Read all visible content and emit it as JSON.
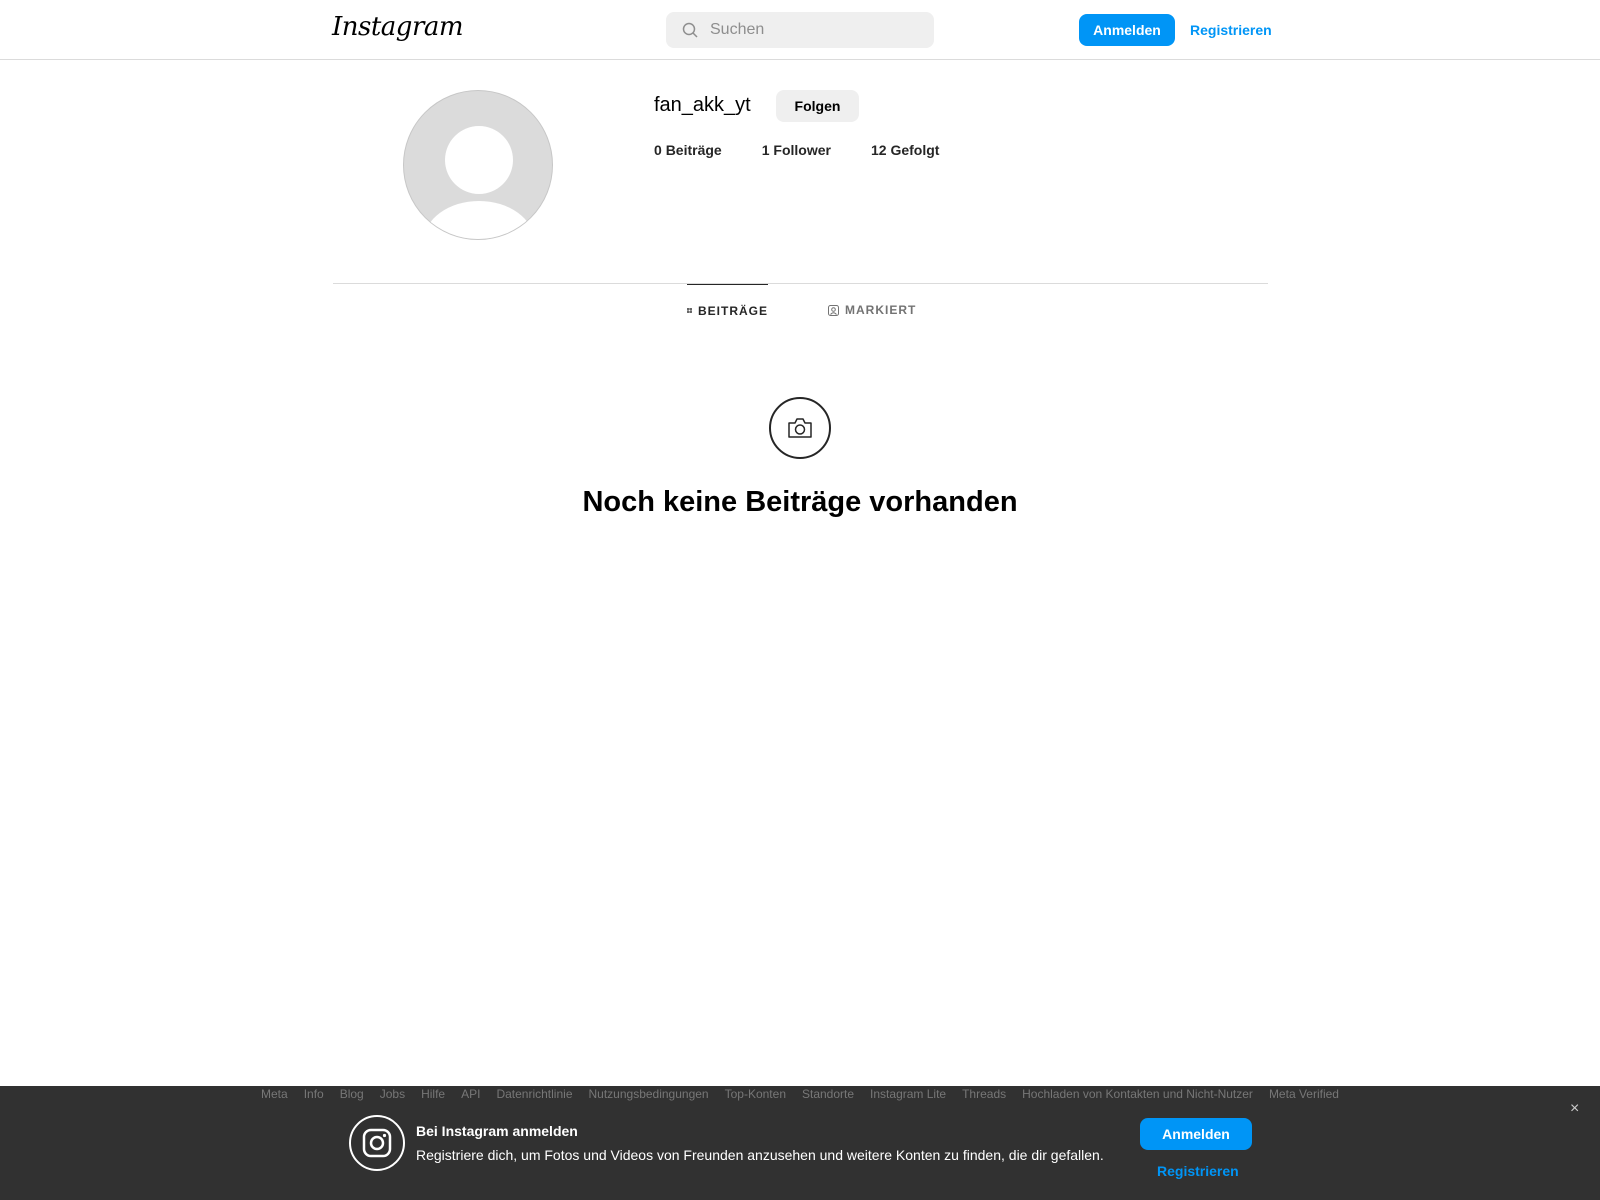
{
  "header": {
    "logo": "Instagram",
    "search_placeholder": "Suchen",
    "login": "Anmelden",
    "register": "Registrieren"
  },
  "profile": {
    "username": "fan_akk_yt",
    "follow": "Folgen",
    "stats": [
      {
        "count": "0",
        "label": "Beiträge"
      },
      {
        "count": "1",
        "label": "Follower"
      },
      {
        "count": "12",
        "label": "Gefolgt"
      }
    ]
  },
  "tabs": [
    {
      "label": "BEITRÄGE",
      "icon": "grid-icon",
      "active": true
    },
    {
      "label": "MARKIERT",
      "icon": "tagged-icon",
      "active": false
    }
  ],
  "empty_state": {
    "icon": "camera-icon",
    "text": "Noch keine Beiträge vorhanden"
  },
  "footer_links": [
    "Meta",
    "Info",
    "Blog",
    "Jobs",
    "Hilfe",
    "API",
    "Datenrichtlinie",
    "Nutzungsbedingungen",
    "Top-Konten",
    "Standorte",
    "Instagram Lite",
    "Threads",
    "Hochladen von Kontakten und Nicht-Nutzer",
    "Meta Verified"
  ],
  "banner": {
    "title": "Bei Instagram anmelden",
    "description": "Registriere dich, um Fotos und Videos von Freunden anzusehen und weitere Konten zu finden, die dir gefallen.",
    "login": "Anmelden",
    "register": "Registrieren",
    "close": "×"
  },
  "colors": {
    "accent": "#0095f6",
    "overlay": "#262626"
  }
}
